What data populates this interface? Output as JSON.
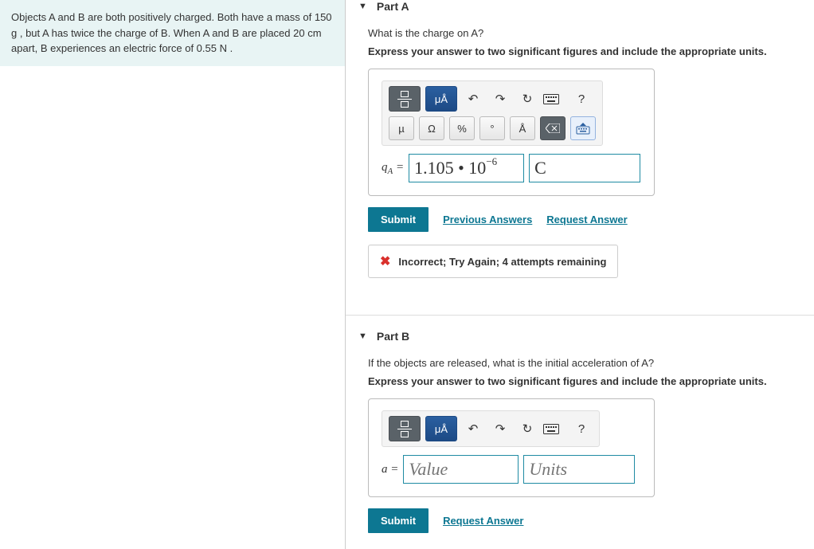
{
  "problem_text": "Objects A and B are both positively charged. Both have a mass of 150 g , but A has twice the charge of B. When A and B are placed 20 cm apart, B experiences an electric force of 0.55 N .",
  "partA": {
    "title": "Part A",
    "question": "What is the charge on A?",
    "instruction": "Express your answer to two significant figures and include the appropriate units.",
    "var_label": "q",
    "var_sub": "A",
    "value_html": "1.105 • 10<sup>−6</sup>",
    "units_value": "C",
    "submit": "Submit",
    "prev_answers": "Previous Answers",
    "request_answer": "Request Answer",
    "feedback": "Incorrect; Try Again; 4 attempts remaining"
  },
  "partB": {
    "title": "Part B",
    "question": "If the objects are released, what is the initial acceleration of A?",
    "instruction": "Express your answer to two significant figures and include the appropriate units.",
    "var_label": "a",
    "value_placeholder": "Value",
    "units_placeholder": "Units",
    "submit": "Submit",
    "request_answer": "Request Answer"
  },
  "toolbar": {
    "units_btn": "μÅ",
    "mu": "µ",
    "omega": "Ω",
    "percent": "%",
    "degree": "°",
    "angstrom": "Å",
    "help": "?"
  }
}
